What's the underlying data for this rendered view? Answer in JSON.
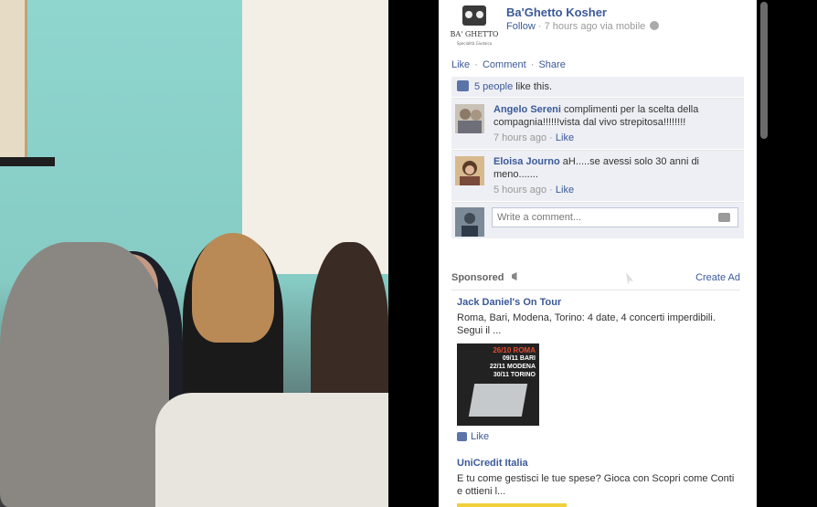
{
  "post": {
    "page_name": "Ba'Ghetto Kosher",
    "logo_text": "BA' GHETTO",
    "logo_subtext": "Specialità Giudaica",
    "follow": "Follow",
    "meta": "· 7 hours ago via mobile",
    "actions": {
      "like": "Like",
      "comment": "Comment",
      "share": "Share",
      "sep": "·"
    },
    "likes_link": "5 people",
    "likes_suffix": " like this."
  },
  "comments": [
    {
      "name": "Angelo Sereni",
      "text": " complimenti per la scelta della compagnia!!!!!!vista dal vivo strepitosa!!!!!!!!",
      "time": "7 hours ago",
      "sep": " · ",
      "like": "Like"
    },
    {
      "name": "Eloisa Journo",
      "text": " aH.....se avessi solo 30 anni di meno.......",
      "time": "5 hours ago",
      "sep": " · ",
      "like": "Like"
    }
  ],
  "composer": {
    "placeholder": "Write a comment..."
  },
  "sponsored": {
    "title": "Sponsored",
    "create_ad": "Create Ad",
    "ads": [
      {
        "title": "Jack Daniel's On Tour",
        "text": "Roma, Bari, Modena, Torino: 4 date, 4 concerti imperdibili. Segui il ...",
        "image_lines": [
          "26/10 ROMA",
          "09/11 BARI",
          "22/11 MODENA",
          "30/11 TORINO"
        ],
        "like": "Like"
      },
      {
        "title": "UniCredit Italia",
        "text": "E tu come gestisci le tue spese? Gioca con Scopri come Conti e ottieni l..."
      }
    ]
  },
  "colors": {
    "link": "#3b5998",
    "ufi_bg": "#edeff4"
  }
}
